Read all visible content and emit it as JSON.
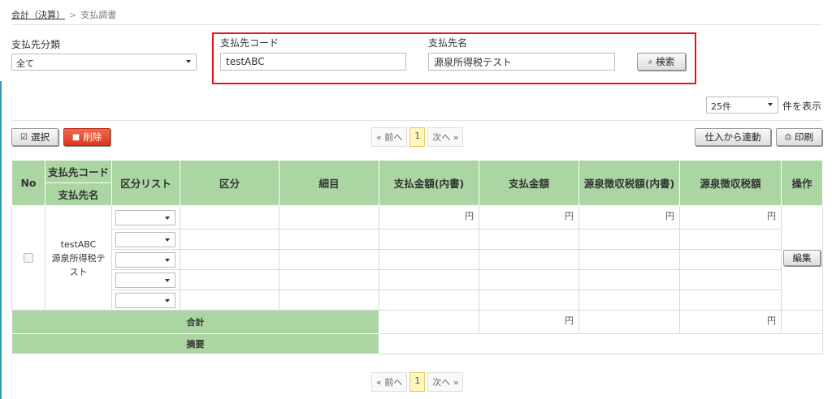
{
  "breadcrumb": {
    "parent": "会計（決算）",
    "separator": ">",
    "current": "支払調書"
  },
  "filters": {
    "category_label": "支払先分類",
    "category_value": "全て",
    "code_label": "支払先コード",
    "code_value": "testABC",
    "name_label": "支払先名",
    "name_value": "源泉所得税テスト",
    "search_label": "検索"
  },
  "per_page": {
    "value": "25件",
    "suffix": "件を表示"
  },
  "toolbar": {
    "select_label": "選択",
    "delete_label": "削除",
    "link_purchase_label": "仕入から連動",
    "print_label": "印刷"
  },
  "pager": {
    "prev": "« 前へ",
    "current": "1",
    "next": "次へ »"
  },
  "table": {
    "headers": {
      "no": "No",
      "code": "支払先コード",
      "name": "支払先名",
      "category_list": "区分リスト",
      "category": "区分",
      "detail": "細目",
      "pay_inner": "支払金額(内書)",
      "pay": "支払金額",
      "tax_inner": "源泉徴収税額(内書)",
      "tax": "源泉徴収税額",
      "ops": "操作"
    },
    "row": {
      "code": "testABC",
      "name": "源泉所得税テスト",
      "yen": "円",
      "edit_label": "編集"
    },
    "total_label": "合計",
    "summary_label": "摘要"
  },
  "colors": {
    "accent_red": "#e8121d",
    "header_green": "#abd5a2"
  }
}
